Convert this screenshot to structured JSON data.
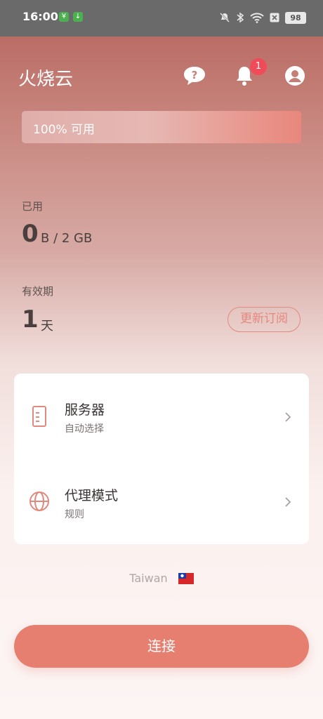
{
  "status_bar": {
    "time": "16:00",
    "battery": "98"
  },
  "header": {
    "title": "火烧云",
    "notification_count": "1"
  },
  "usage_bar": {
    "text": "100% 可用",
    "fill_percent": 100
  },
  "used": {
    "label": "已用",
    "value": "0",
    "unit": "B / 2 GB"
  },
  "validity": {
    "label": "有效期",
    "value": "1",
    "unit": "天",
    "renew_label": "更新订阅"
  },
  "server_row": {
    "title": "服务器",
    "subtitle": "自动选择"
  },
  "proxy_row": {
    "title": "代理模式",
    "subtitle": "规则"
  },
  "location": {
    "country": "Taiwan"
  },
  "connect_label": "连接",
  "colors": {
    "accent": "#e77f71",
    "badge": "#ef4b58",
    "header_top": "#b4625b"
  }
}
